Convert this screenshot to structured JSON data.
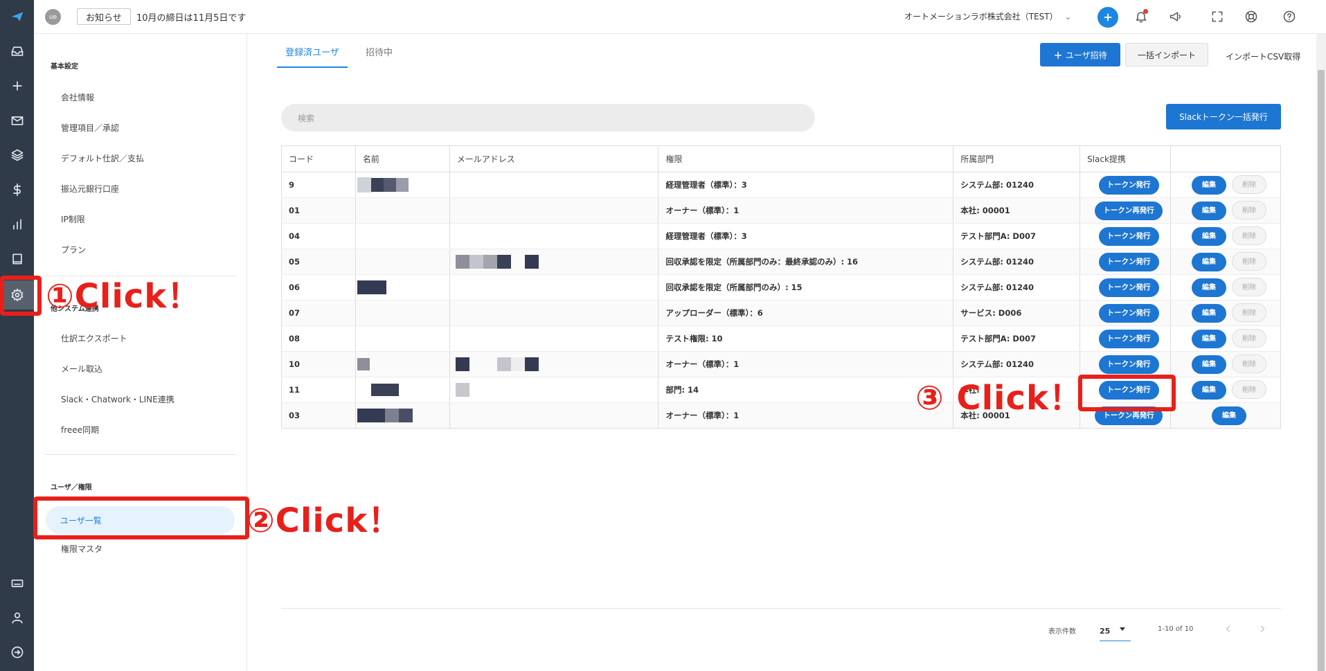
{
  "topbar": {
    "avatar": "ue",
    "notice_button": "お知らせ",
    "notice_text": "10月の締日は11月5日です",
    "company": "オートメーションラボ株式会社（TEST）"
  },
  "sidebar": {
    "basic_heading": "基本設定",
    "basic_items": [
      "会社情報",
      "管理項目／承認",
      "デフォルト仕訳／支払",
      "振込元銀行口座",
      "IP制限",
      "プラン"
    ],
    "system_heading_partial": "他システム連携",
    "system_items": [
      "仕訳エクスポート",
      "メール取込",
      "Slack・Chatwork・LINE連携",
      "freee同期"
    ],
    "user_heading": "ユーザ／権限",
    "user_items": [
      "ユーザ一覧",
      "権限マスタ"
    ]
  },
  "tabs": {
    "registered": "登録済ユーザ",
    "invited": "招待中"
  },
  "actions": {
    "invite": "ユーザ招待",
    "bulk_import": "一括インポート",
    "import_csv": "インポートCSV取得",
    "slack_bulk": "Slackトークン一括発行"
  },
  "search": {
    "placeholder": "検索"
  },
  "table": {
    "headers": [
      "コード",
      "名前",
      "メールアドレス",
      "権限",
      "所属部門",
      "Slack提携",
      ""
    ],
    "edit_label": "編集",
    "delete_label": "削除",
    "rows": [
      {
        "code": "9",
        "role": "経理管理者（標準）：3",
        "dept": "システム部: 01240",
        "token": "トークン発行"
      },
      {
        "code": "01",
        "role": "オーナー（標準）：1",
        "dept": "本社: 00001",
        "token": "トークン再発行"
      },
      {
        "code": "04",
        "role": "経理管理者（標準）：3",
        "dept": "テスト部門A: D007",
        "token": "トークン発行"
      },
      {
        "code": "05",
        "role": "回収承認を限定（所属部門のみ：最終承認のみ）: 16",
        "dept": "システム部: 01240",
        "token": "トークン発行"
      },
      {
        "code": "06",
        "role": "回収承認を限定（所属部門のみ）: 15",
        "dept": "システム部: 01240",
        "token": "トークン発行"
      },
      {
        "code": "07",
        "role": "アップローダー（標準）：6",
        "dept": "サービス: D006",
        "token": "トークン発行"
      },
      {
        "code": "08",
        "role": "テスト権限: 10",
        "dept": "テスト部門A: D007",
        "token": "トークン発行"
      },
      {
        "code": "10",
        "role": "オーナー（標準）：1",
        "dept": "システム部: 01240",
        "token": "トークン発行"
      },
      {
        "code": "11",
        "role": "部門: 14",
        "dept": "本社:",
        "token": "トークン発行"
      },
      {
        "code": "03",
        "role": "オーナー（標準）：1",
        "dept": "本社: 00001",
        "token": "トークン再発行"
      }
    ]
  },
  "pagination": {
    "per_page_label": "表示件数",
    "per_page": "25",
    "range": "1-10 of 10"
  },
  "annotations": {
    "step1": "①Click！",
    "step2": "②Click！",
    "step3": "③ Click！"
  },
  "colors": {
    "accent": "#1d76d2",
    "annotation": "#e8201a",
    "rail": "#2f3b48"
  }
}
